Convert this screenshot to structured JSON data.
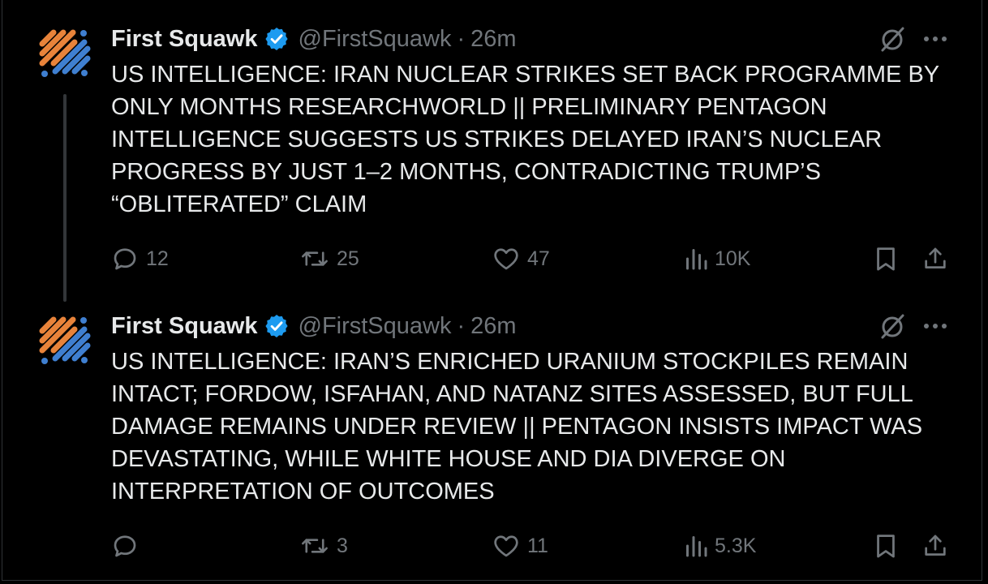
{
  "tweets": [
    {
      "author": {
        "name": "First Squawk",
        "handle": "@FirstSquawk",
        "verified": true
      },
      "time": "26m",
      "separator": "·",
      "text": "US INTELLIGENCE: IRAN NUCLEAR STRIKES SET BACK PROGRAMME BY ONLY MONTHS RESEARCHWORLD || PRELIMINARY PENTAGON INTELLIGENCE SUGGESTS US STRIKES DELAYED IRAN’S NUCLEAR PROGRESS BY JUST 1–2 MONTHS, CONTRADICTING TRUMP’S “OBLITERATED” CLAIM",
      "stats": {
        "replies": "12",
        "retweets": "25",
        "likes": "47",
        "views": "10K"
      }
    },
    {
      "author": {
        "name": "First Squawk",
        "handle": "@FirstSquawk",
        "verified": true
      },
      "time": "26m",
      "separator": "·",
      "text": "US INTELLIGENCE: IRAN’S ENRICHED URANIUM STOCKPILES REMAIN INTACT; FORDOW, ISFAHAN, AND NATANZ SITES ASSESSED, BUT FULL DAMAGE REMAINS UNDER REVIEW || PENTAGON INSISTS IMPACT WAS DEVASTATING, WHILE WHITE HOUSE AND DIA DIVERGE ON INTERPRETATION OF OUTCOMES",
      "stats": {
        "replies": "",
        "retweets": "3",
        "likes": "11",
        "views": "5.3K"
      }
    }
  ],
  "icons": {
    "reply": "reply-icon",
    "retweet": "retweet-icon",
    "like": "heart-icon",
    "views": "views-icon",
    "bookmark": "bookmark-icon",
    "share": "share-icon",
    "grok": "grok-icon",
    "more": "more-icon",
    "verified": "verified-badge-icon"
  },
  "colors": {
    "background": "#000000",
    "text": "#e7e9ea",
    "secondary": "#71767b",
    "verified": "#1d9bf0",
    "avatar_orange": "#e8833a",
    "avatar_blue": "#3f7fd0",
    "divider": "#2f3336"
  }
}
